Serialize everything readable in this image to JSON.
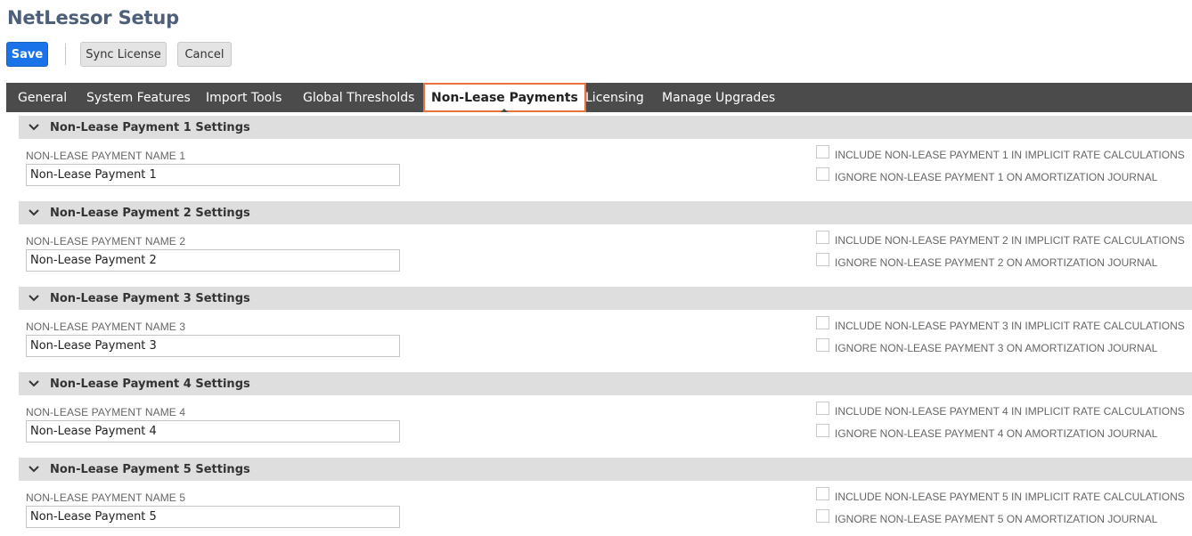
{
  "page": {
    "title": "NetLessor Setup"
  },
  "toolbar": {
    "save": "Save",
    "sync": "Sync License",
    "cancel": "Cancel"
  },
  "tabs": [
    {
      "label": "General"
    },
    {
      "label": "System Features"
    },
    {
      "label": "Import Tools"
    },
    {
      "label": "Global Thresholds"
    },
    {
      "label": "Non-Lease Payments",
      "active": true
    },
    {
      "label": "Licensing"
    },
    {
      "label": "Manage Upgrades"
    }
  ],
  "sections": [
    {
      "header": "Non-Lease Payment 1 Settings",
      "name_label": "NON-LEASE PAYMENT NAME 1",
      "name_value": "Non-Lease Payment 1",
      "include_label": "INCLUDE NON-LEASE PAYMENT 1 IN IMPLICIT RATE CALCULATIONS",
      "ignore_label": "IGNORE NON-LEASE PAYMENT 1 ON AMORTIZATION JOURNAL",
      "include_checked": false,
      "ignore_checked": false
    },
    {
      "header": "Non-Lease Payment 2 Settings",
      "name_label": "NON-LEASE PAYMENT NAME 2",
      "name_value": "Non-Lease Payment 2",
      "include_label": "INCLUDE NON-LEASE PAYMENT 2 IN IMPLICIT RATE CALCULATIONS",
      "ignore_label": "IGNORE NON-LEASE PAYMENT 2 ON AMORTIZATION JOURNAL",
      "include_checked": false,
      "ignore_checked": false
    },
    {
      "header": "Non-Lease Payment 3 Settings",
      "name_label": "NON-LEASE PAYMENT NAME 3",
      "name_value": "Non-Lease Payment 3",
      "include_label": "INCLUDE NON-LEASE PAYMENT 3 IN IMPLICIT RATE CALCULATIONS",
      "ignore_label": "IGNORE NON-LEASE PAYMENT 3 ON AMORTIZATION JOURNAL",
      "include_checked": false,
      "ignore_checked": false
    },
    {
      "header": "Non-Lease Payment 4 Settings",
      "name_label": "NON-LEASE PAYMENT NAME 4",
      "name_value": "Non-Lease Payment 4",
      "include_label": "INCLUDE NON-LEASE PAYMENT 4 IN IMPLICIT RATE CALCULATIONS",
      "ignore_label": "IGNORE NON-LEASE PAYMENT 4 ON AMORTIZATION JOURNAL",
      "include_checked": false,
      "ignore_checked": false
    },
    {
      "header": "Non-Lease Payment 5 Settings",
      "name_label": "NON-LEASE PAYMENT NAME 5",
      "name_value": "Non-Lease Payment 5",
      "include_label": "INCLUDE NON-LEASE PAYMENT 5 IN IMPLICIT RATE CALCULATIONS",
      "ignore_label": "IGNORE NON-LEASE PAYMENT 5 ON AMORTIZATION JOURNAL",
      "include_checked": false,
      "ignore_checked": false
    }
  ],
  "icons": {
    "section_toggle": "chevron-down-icon"
  },
  "colors": {
    "primary": "#1a73e8",
    "active_tab_border": "#e8733b",
    "tabbar": "#4b4b4b",
    "title": "#4d5f79"
  }
}
